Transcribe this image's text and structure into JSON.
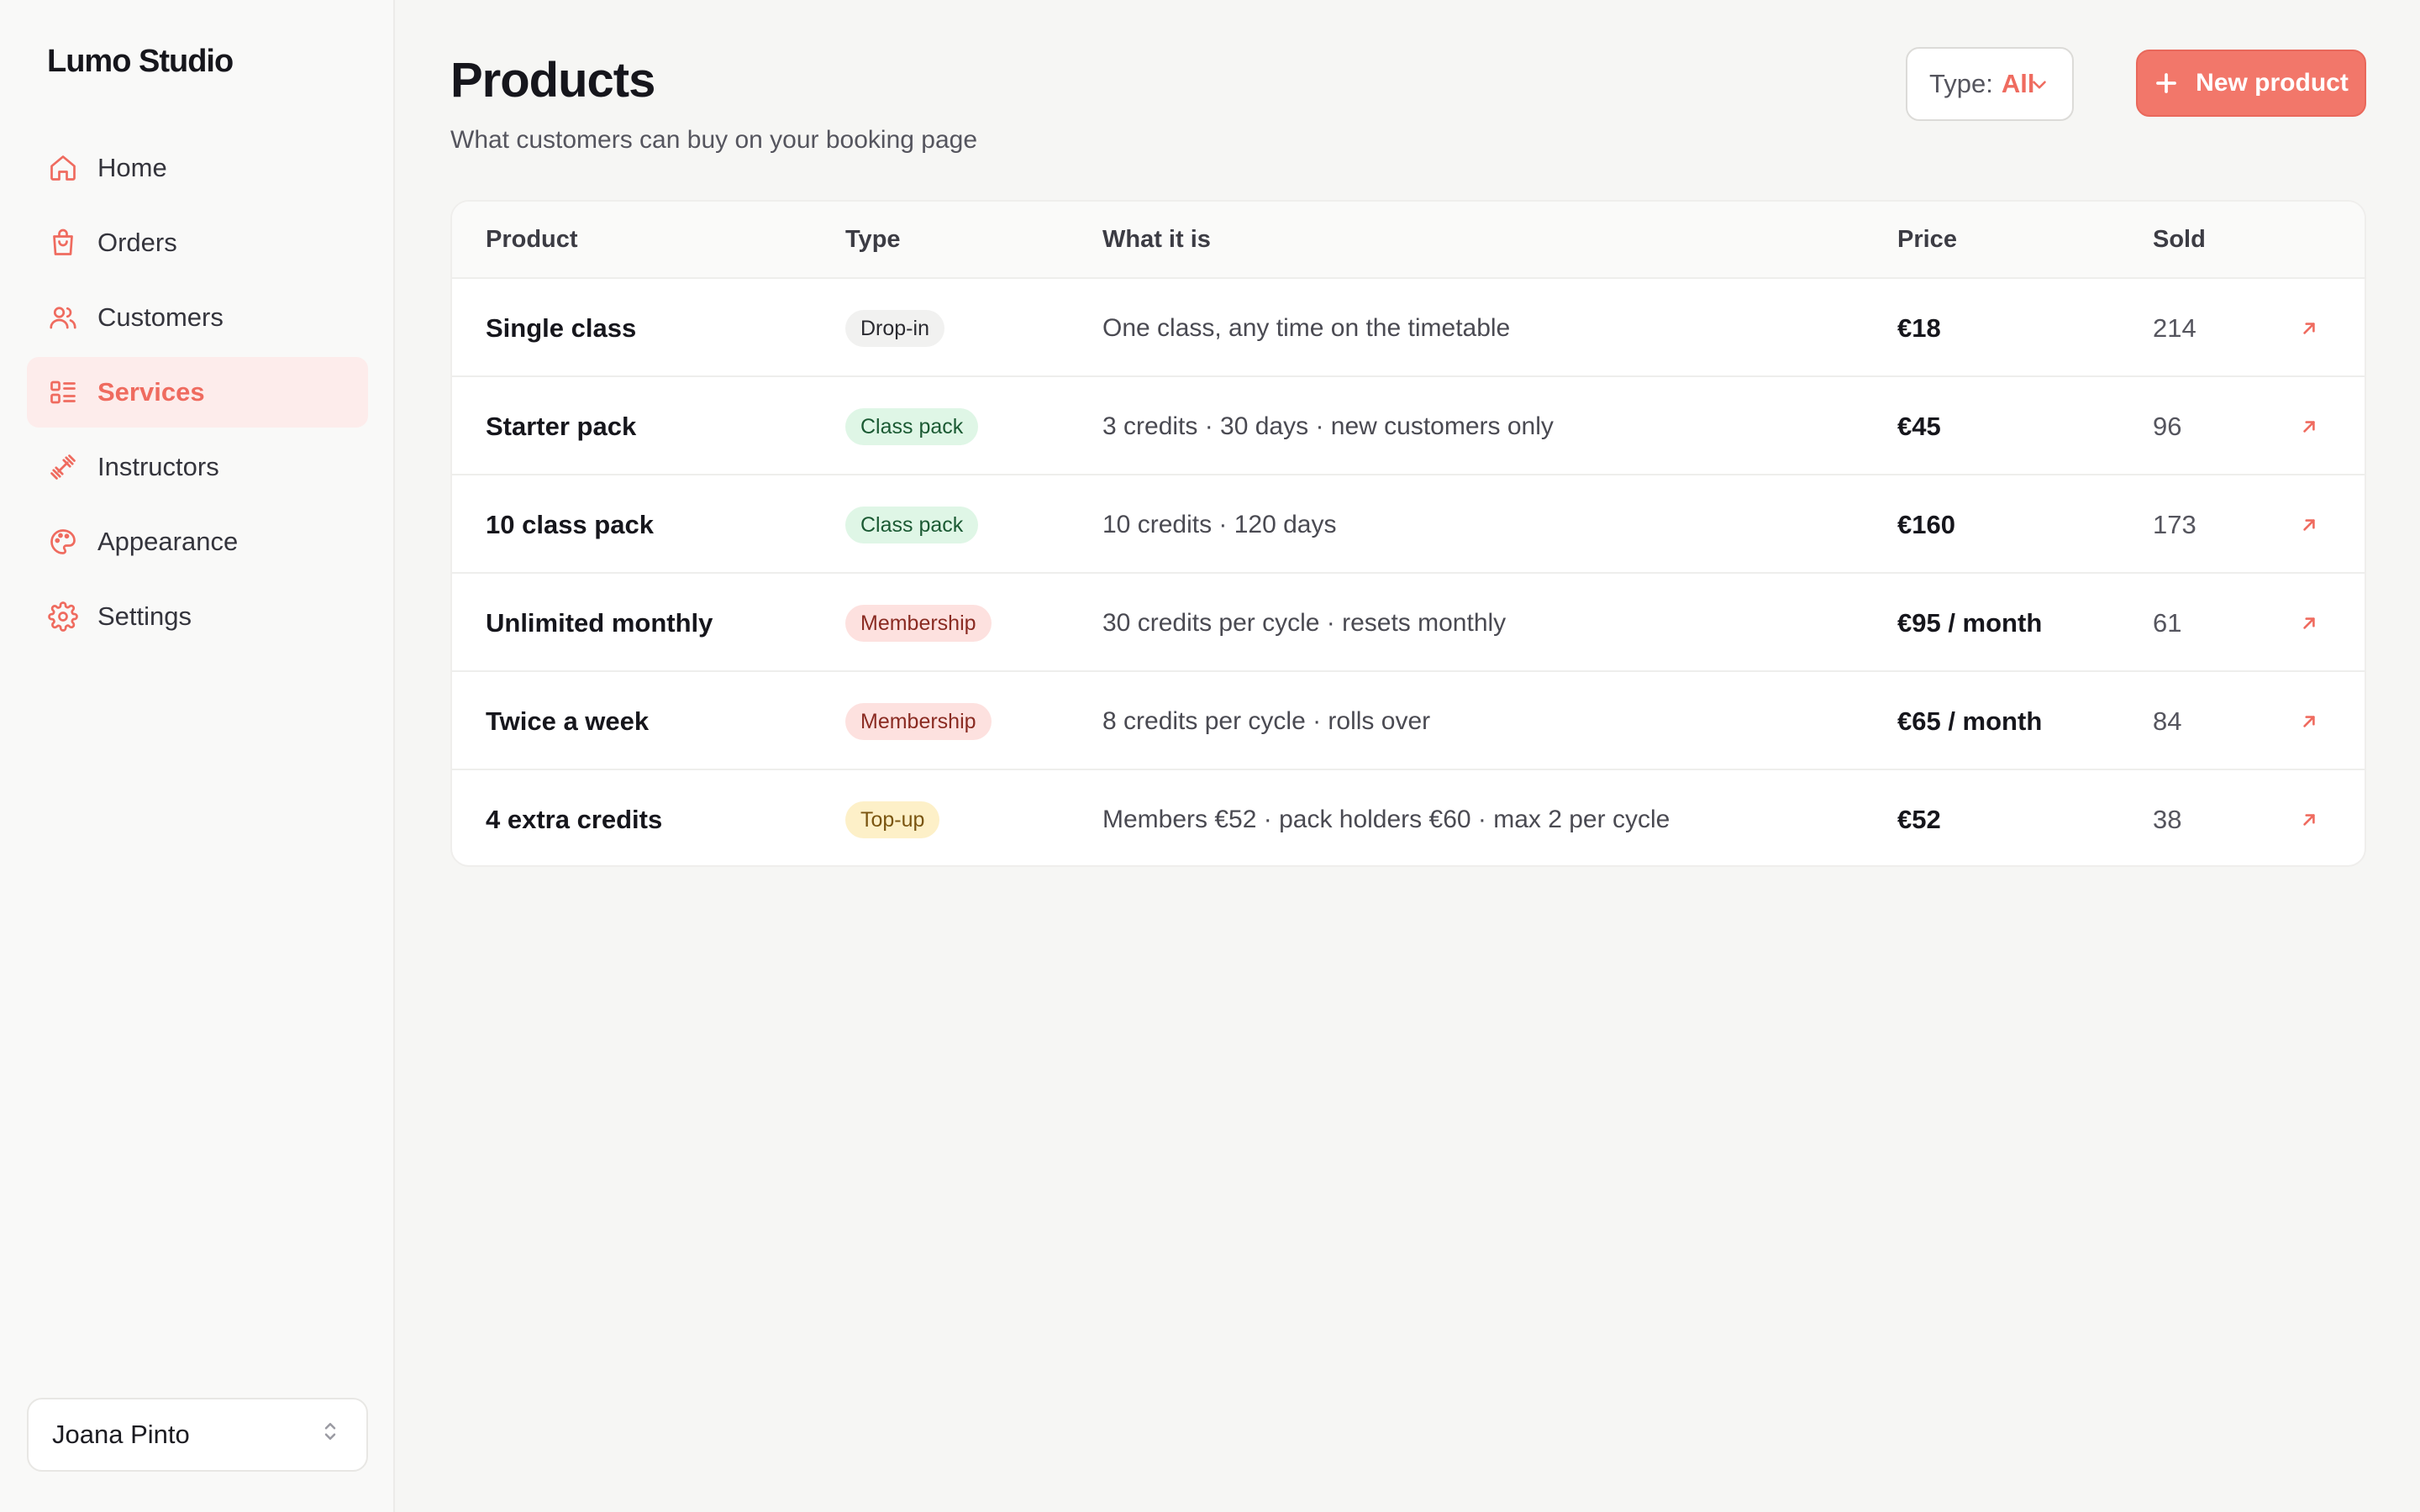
{
  "app": {
    "brand": "Lumo Studio"
  },
  "sidebar": {
    "items": [
      {
        "label": "Home",
        "icon": "home-icon"
      },
      {
        "label": "Orders",
        "icon": "bag-icon"
      },
      {
        "label": "Customers",
        "icon": "users-icon"
      },
      {
        "label": "Services",
        "icon": "list-icon",
        "active": true
      },
      {
        "label": "Instructors",
        "icon": "dumbbell-icon"
      },
      {
        "label": "Appearance",
        "icon": "palette-icon"
      },
      {
        "label": "Settings",
        "icon": "gear-icon"
      }
    ],
    "user": "Joana Pinto"
  },
  "header": {
    "title": "Products",
    "subtitle": "What customers can buy on your booking page",
    "filter_label": "Type:",
    "filter_value": "All",
    "new_button_label": "New product"
  },
  "table": {
    "columns": [
      "Product",
      "Type",
      "What it is",
      "Price",
      "Sold"
    ],
    "rows": [
      {
        "product": "Single class",
        "type": "Drop-in",
        "type_style": "dropin",
        "what": "One class, any time on the timetable",
        "price": "€18",
        "sold": "214"
      },
      {
        "product": "Starter pack",
        "type": "Class pack",
        "type_style": "classpack",
        "what": "3 credits · 30 days · new customers only",
        "price": "€45",
        "sold": "96"
      },
      {
        "product": "10 class pack",
        "type": "Class pack",
        "type_style": "classpack",
        "what": "10 credits · 120 days",
        "price": "€160",
        "sold": "173"
      },
      {
        "product": "Unlimited monthly",
        "type": "Membership",
        "type_style": "membership",
        "what": "30 credits per cycle · resets monthly",
        "price": "€95 / month",
        "sold": "61"
      },
      {
        "product": "Twice a week",
        "type": "Membership",
        "type_style": "membership",
        "what": "8 credits per cycle · rolls over",
        "price": "€65 / month",
        "sold": "84"
      },
      {
        "product": "4 extra credits",
        "type": "Top-up",
        "type_style": "topup",
        "what": "Members €52 · pack holders €60 · max 2 per cycle",
        "price": "€52",
        "sold": "38"
      }
    ]
  },
  "colors": {
    "accent": "#ef6b5f",
    "background": "#f6f6f4",
    "sidebar_bg": "#f9f9f8"
  }
}
